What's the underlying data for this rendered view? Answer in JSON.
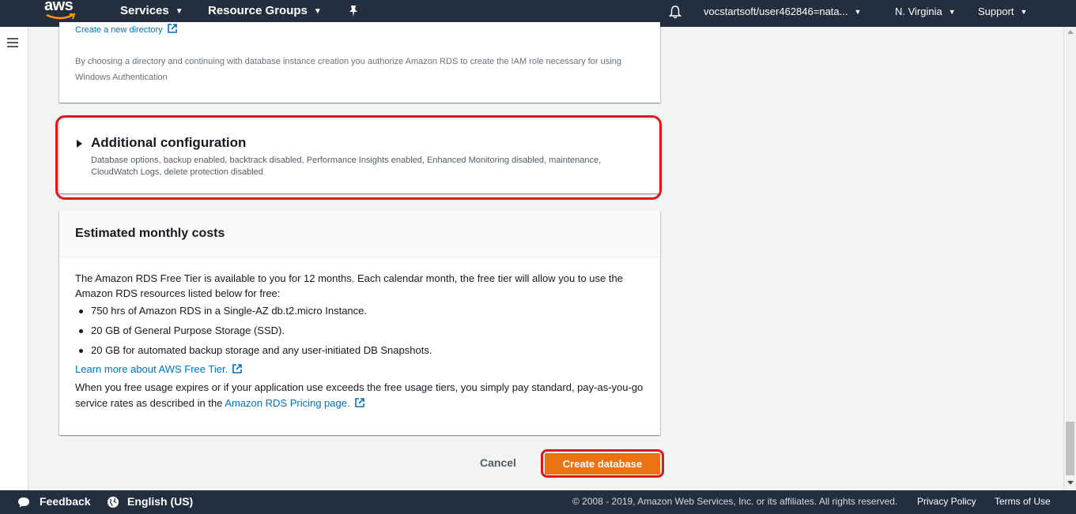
{
  "nav": {
    "logo": "aws",
    "services": "Services",
    "resource_groups": "Resource Groups",
    "account": "vocstartsoft/user462846=nata...",
    "region": "N. Virginia",
    "support": "Support",
    "icons": [
      "bell-icon",
      "pin-icon",
      "chevron-down-icon"
    ]
  },
  "directory_section": {
    "create_link": "Create a new directory",
    "note": "By choosing a directory and continuing with database instance creation you authorize Amazon RDS to create the IAM role necessary for using Windows Authentication"
  },
  "additional_config": {
    "title": "Additional configuration",
    "description": "Database options, backup enabled, backtrack disabled, Performance Insights enabled, Enhanced Monitoring disabled, maintenance, CloudWatch Logs, delete protection disabled"
  },
  "costs": {
    "title": "Estimated monthly costs",
    "intro": "The Amazon RDS Free Tier is available to you for 12 months. Each calendar month, the free tier will allow you to use the Amazon RDS resources listed below for free:",
    "items": [
      "750 hrs of Amazon RDS in a Single-AZ db.t2.micro Instance.",
      "20 GB of General Purpose Storage (SSD).",
      "20 GB for automated backup storage and any user-initiated DB Snapshots."
    ],
    "learn_more": "Learn more about AWS Free Tier.",
    "para2_prefix": "When you free usage expires or if your application use exceeds the free usage tiers, you simply pay standard, pay-as-you-go service rates as described in the ",
    "pricing_link": "Amazon RDS Pricing page."
  },
  "actions": {
    "cancel": "Cancel",
    "create": "Create database"
  },
  "footer": {
    "feedback": "Feedback",
    "language": "English (US)",
    "copyright": "© 2008 - 2019, Amazon Web Services, Inc. or its affiliates. All rights reserved.",
    "privacy": "Privacy Policy",
    "terms": "Terms of Use"
  },
  "colors": {
    "nav_bg": "#232f3e",
    "link": "#0073bb",
    "primary_button": "#ec7211",
    "highlight": "#e0161e"
  }
}
